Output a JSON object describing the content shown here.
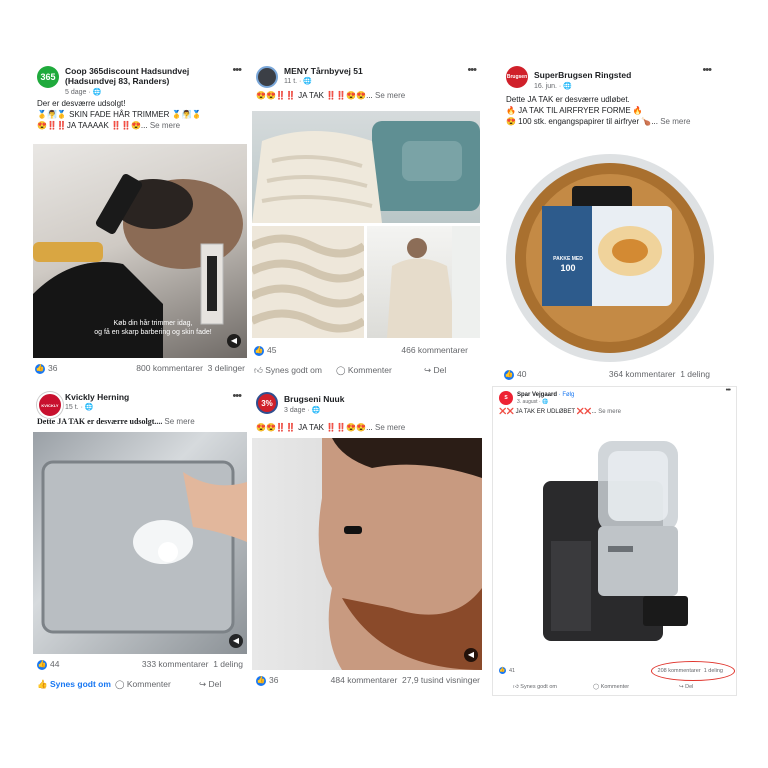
{
  "posts": [
    {
      "id": "coop",
      "name": "Coop 365discount Hadsundvej",
      "name2": "(Hadsundvej 83, Randers)",
      "time": "5 dage · ",
      "lines": [
        "Der er desværre udsolgt!",
        "🥇🧖‍♂️🥇 SKIN FADE HÅR TRIMMER 🥇🧖‍♂️🥇",
        "😍‼️‼️JA TAAAAK ‼️‼️😍..."
      ],
      "more": "Se mere",
      "likes": "36",
      "comments": "800 kommentarer",
      "shares": "3 delinger",
      "overlay_line1": "Køb din hår trimmer idag,",
      "overlay_line2": "og få en skarp barbering og skin fade!"
    },
    {
      "id": "meny",
      "name": "MENY Tårnbyvej 51",
      "time": "11 t. · ",
      "lines": [
        "😍😍‼️‼️ JA TAK ‼️‼️😍😍..."
      ],
      "more": "Se mere",
      "likes": "45",
      "comments": "466 kommentarer",
      "actions": [
        "Synes godt om",
        "Kommenter",
        "Del"
      ]
    },
    {
      "id": "superbrugsen",
      "name": "SuperBrugsen Ringsted",
      "time": "16. jun. · ",
      "lines": [
        "Dette JA TAK er desværre udløbet.",
        "🔥 JA TAK TIL AIRFRYER FORME 🔥",
        "😍 100 stk. engangspapirer til airfryer 🍗..."
      ],
      "more": "Se mere",
      "likes": "40",
      "comments": "364 kommentarer",
      "shares": "1 deling",
      "pack_line1": "PAKKE MED",
      "pack_line2": "100"
    },
    {
      "id": "kvickly",
      "name": "Kvickly Herning",
      "time": "15 t. · ",
      "lines": [
        "Dette JA TAK er desværre udsolgt...."
      ],
      "more": "Se mere",
      "likes": "44",
      "comments": "333 kommentarer",
      "shares": "1 deling",
      "actions": [
        "Synes godt om",
        "Kommenter",
        "Del"
      ]
    },
    {
      "id": "brugseni",
      "name": "Brugseni Nuuk",
      "time": "3 dage · ",
      "avatar_text": "3%",
      "lines": [
        "😍😍‼️‼️ JA TAK ‼️‼️😍😍..."
      ],
      "more": "Se mere",
      "likes": "36",
      "comments": "484 kommentarer",
      "views": "27,9 tusind visninger"
    },
    {
      "id": "spar",
      "name": "Spar Vejgaard",
      "follow": "· Følg",
      "time": "3. august · ",
      "lines": [
        "❌❌ JA TAK ER UDLØBET ❌❌..."
      ],
      "more": "Se mere",
      "likes": "41",
      "comments": "208 kommentarer",
      "shares": "1 deling",
      "actions": [
        "Synes godt om",
        "Kommenter",
        "Del"
      ]
    }
  ],
  "icons": {
    "like": "thumbs-up-icon",
    "comment": "speech-bubble-icon",
    "share": "share-arrow-icon",
    "globe": "globe-icon",
    "more": "more-dots-icon",
    "sound": "speaker-icon"
  },
  "colors": {
    "facebook_blue": "#1877f2",
    "coop_green": "#1faa3c",
    "superbrugsen_red": "#d0202a",
    "kvickly_red": "#c8102e",
    "annotation_red": "#e0342c"
  }
}
